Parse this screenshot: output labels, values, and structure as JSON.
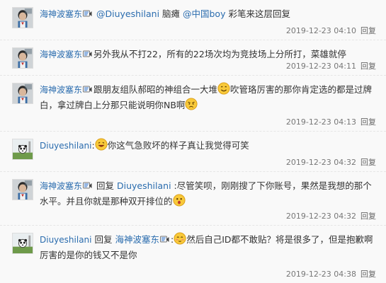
{
  "replies": [
    {
      "user": "海神波塞东",
      "vip": true,
      "parts": [
        "",
        "@Diuyeshilani",
        " 脑瘫 ",
        "@中国boy",
        " 彩笔来这层回复"
      ],
      "time": "2019-12-23 04:10",
      "reply_label": "回复"
    },
    {
      "user": "海神波塞东",
      "vip": true,
      "text": "另外我从不打22，所有的22场次均为竞技场上分所打，菜雄就停",
      "time": "2019-12-23 04:11",
      "reply_label": "回复"
    },
    {
      "user": "海神波塞东",
      "vip": true,
      "text_a": "跟朋友组队郝昭的神组合一大堆",
      "text_b": "吹管珞厉害的那你肯定选的都是过牌白，拿过牌白上分那只能说明你NB啊",
      "time": "2019-12-23 04:13",
      "reply_label": "回复"
    },
    {
      "user": "Diuyeshilani",
      "vip": false,
      "text": "你这气急败坏的样子真让我觉得可笑",
      "time": "2019-12-23 04:32",
      "reply_label": "回复"
    },
    {
      "user": "海神波塞东",
      "vip": true,
      "reply_word": "回复",
      "target": "Diuyeshilani",
      "text": ":尽管笑呗，刚刚搜了下你账号，果然是我想的那个水平。并且你就是那种双开排位的",
      "time": "2019-12-23 04:32",
      "reply_label": "回复"
    },
    {
      "user": "Diuyeshilani",
      "vip": false,
      "reply_word": "回复",
      "target": "海神波塞东",
      "text": "然后自己ID都不敢贴？将是很多了，但是抱歉啊厉害的是你的钱又不是你",
      "time": "2019-12-23 04:38",
      "reply_label": "回复"
    }
  ],
  "colors": {
    "link": "#2a6cae",
    "text": "#333333",
    "meta": "#777777",
    "background": "#f9f9f9"
  },
  "icons": [
    "vip-badge-icon",
    "avatar-image",
    "smile-emoji-icon",
    "angry-emoji-icon",
    "laugh-emoji-icon",
    "shocked-emoji-icon",
    "blush-emoji-icon"
  ]
}
